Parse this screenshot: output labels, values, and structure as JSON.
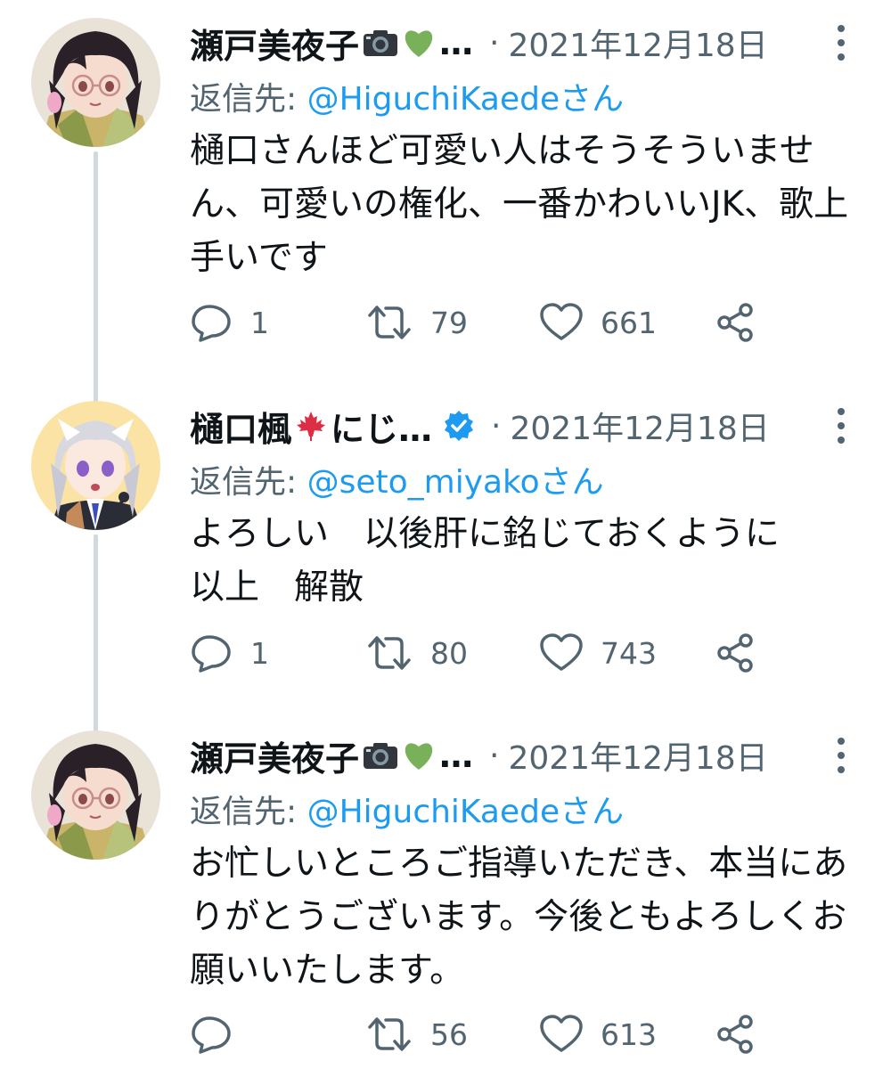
{
  "tweets": [
    {
      "author": "瀬戸美夜子",
      "ellipsis": "…",
      "date_sep": "·",
      "date": "2021年12月18日",
      "reply_prefix": "返信先: ",
      "reply_handle": "@HiguchiKaedeさん",
      "text": "樋口さんほど可愛い人はそうそういません、可愛いの権化、一番かわいいJK、歌上手いです",
      "replies": "1",
      "retweets": "79",
      "likes": "661",
      "avatar_icon": "dark-haired-girl-with-glasses-avatar",
      "name_icons": [
        "camera-icon",
        "green-heart-icon"
      ]
    },
    {
      "author": "樋口楓",
      "ellipsis": "にじ…",
      "date_sep": "·",
      "date": "2021年12月18日",
      "reply_prefix": "返信先: ",
      "reply_handle": "@seto_miyakoさん",
      "text": "よろしい　以後肝に銘じておくように\n以上　解散",
      "replies": "1",
      "retweets": "80",
      "likes": "743",
      "avatar_icon": "silver-haired-girl-avatar",
      "name_icons": [
        "maple-leaf-icon",
        "verified-badge-icon"
      ]
    },
    {
      "author": "瀬戸美夜子",
      "ellipsis": "…",
      "date_sep": "·",
      "date": "2021年12月18日",
      "reply_prefix": "返信先: ",
      "reply_handle": "@HiguchiKaedeさん",
      "text": "お忙しいところご指導いただき、本当にありがとうございます。今後ともよろしくお願いいたします。",
      "replies": "",
      "retweets": "56",
      "likes": "613",
      "avatar_icon": "dark-haired-girl-with-glasses-avatar",
      "name_icons": [
        "camera-icon",
        "green-heart-icon"
      ]
    }
  ],
  "colors": {
    "text": "#0f1419",
    "secondary": "#536471",
    "link": "#1d9bf0",
    "thread_line": "#cfd9de",
    "green_heart": "#78b159",
    "maple": "#dd2e44"
  }
}
